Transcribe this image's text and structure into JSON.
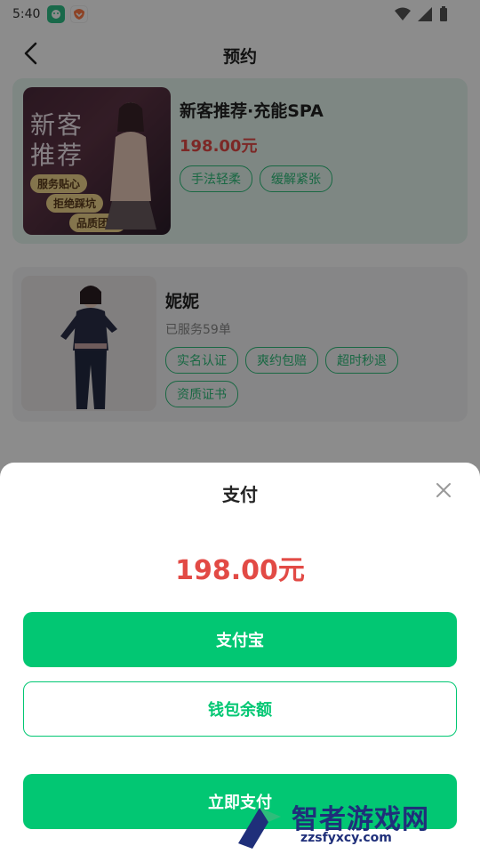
{
  "status_bar": {
    "time": "5:40"
  },
  "header": {
    "title": "预约"
  },
  "card1": {
    "title": "新客推荐·充能SPA",
    "price": "198.00元",
    "tags": [
      "手法轻柔",
      "缓解紧张"
    ],
    "image_text": {
      "headline": "新客\n推荐",
      "pills": [
        "服务贴心",
        "拒绝踩坑",
        "品质团队"
      ]
    }
  },
  "card2": {
    "name": "妮妮",
    "served": "已服务59单",
    "tags": [
      "实名认证",
      "爽约包赔",
      "超时秒退",
      "资质证书"
    ]
  },
  "sheet": {
    "title": "支付",
    "amount": "198.00元",
    "alipay_label": "支付宝",
    "wallet_label": "钱包余额",
    "pay_label": "立即支付"
  },
  "watermark": {
    "brand": "智者游戏网",
    "url": "zzsfyxcy.com"
  },
  "colors": {
    "accent": "#02c773",
    "price": "#e24a45",
    "overlay": "rgba(0,0,0,0.45)"
  }
}
